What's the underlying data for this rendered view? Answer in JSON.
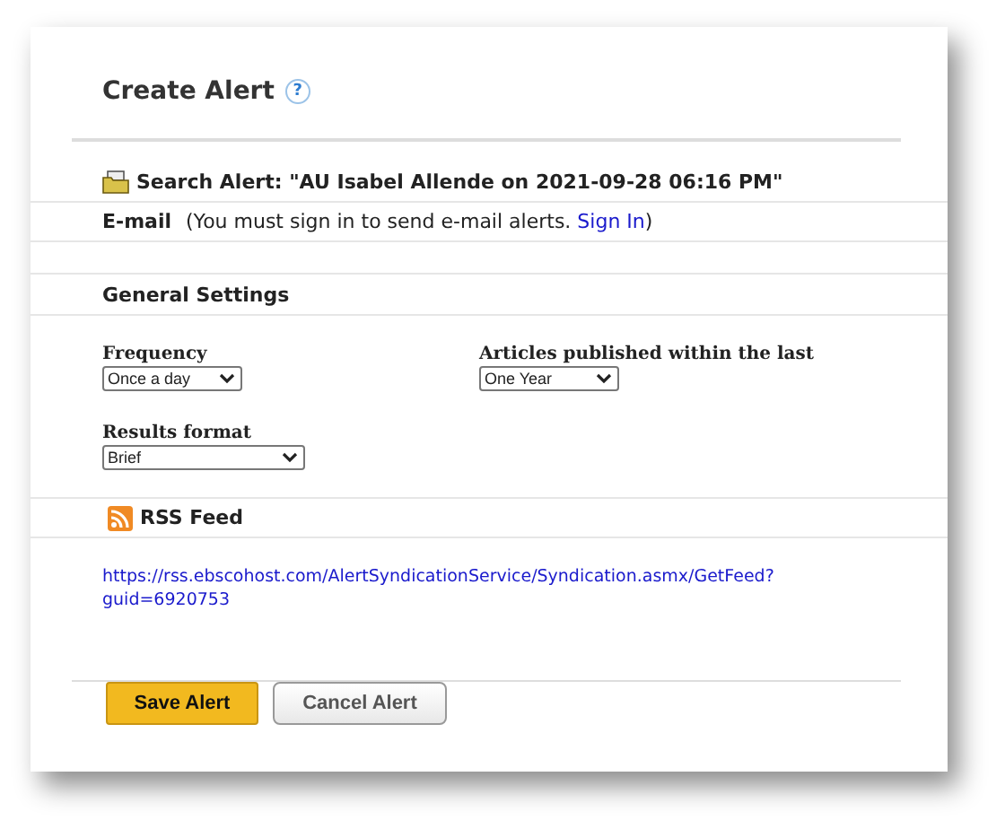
{
  "title": "Create Alert",
  "help": "?",
  "search_alert": "Search Alert: \"AU Isabel Allende on 2021-09-28 06:16 PM\"",
  "email": {
    "label": "E-mail",
    "note_before": "(You must sign in to send e-mail alerts. ",
    "link": "Sign In",
    "note_after": ")"
  },
  "general_settings": {
    "heading": "General Settings",
    "fields": [
      {
        "label": "Frequency",
        "value": "Once a day"
      },
      {
        "label": "Articles published within the last",
        "value": "One Year"
      },
      {
        "label": "Results format",
        "value": "Brief"
      }
    ]
  },
  "rss": {
    "heading": "RSS Feed",
    "url_lines": [
      "https://rss.ebscohost.com/AlertSyndicationService/Syndication.asmx/GetFeed?",
      "guid=6920753"
    ]
  },
  "buttons": [
    {
      "label": "Save Alert",
      "kind": "primary"
    },
    {
      "label": "Cancel Alert",
      "kind": "secondary"
    }
  ]
}
